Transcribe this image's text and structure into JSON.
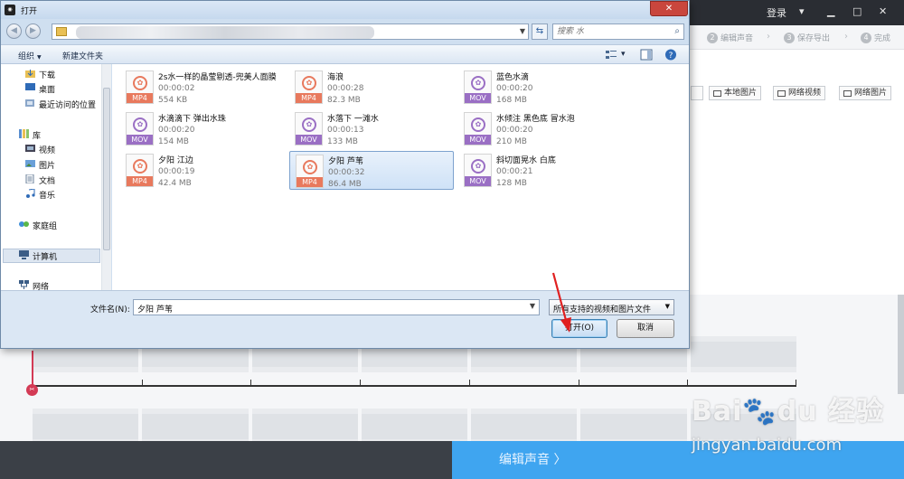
{
  "app": {
    "topbar": {
      "login_label": "登录"
    },
    "steps": [
      {
        "num": "2",
        "label": "编辑声音"
      },
      {
        "num": "3",
        "label": "保存导出"
      },
      {
        "num": "4",
        "label": "完成"
      }
    ],
    "media_buttons": [
      "本地图片",
      "网络视频",
      "网络图片"
    ],
    "next_button_label": "编辑声音 〉"
  },
  "dialog": {
    "title": "打开",
    "close_label": "✕",
    "search_placeholder": "搜索 水",
    "toolbar": {
      "organize_label": "组织",
      "new_folder_label": "新建文件夹"
    },
    "nav_items": [
      {
        "label": "下载",
        "icon": "download-folder-icon"
      },
      {
        "label": "桌面",
        "icon": "desktop-icon"
      },
      {
        "label": "最近访问的位置",
        "icon": "recent-places-icon"
      },
      {
        "label": "库",
        "icon": "library-icon"
      },
      {
        "label": "视频",
        "icon": "videos-icon"
      },
      {
        "label": "图片",
        "icon": "pictures-icon"
      },
      {
        "label": "文档",
        "icon": "documents-icon"
      },
      {
        "label": "音乐",
        "icon": "music-icon"
      },
      {
        "label": "家庭组",
        "icon": "homegroup-icon"
      },
      {
        "label": "计算机",
        "icon": "computer-icon"
      },
      {
        "label": "网络",
        "icon": "network-icon"
      }
    ],
    "files": [
      {
        "name": "2s水一样的晶莹剔透-兜美人面膜",
        "duration": "00:00:02",
        "size": "554 KB",
        "format": "MP4"
      },
      {
        "name": "海浪",
        "duration": "00:00:28",
        "size": "82.3 MB",
        "format": "MP4"
      },
      {
        "name": "蓝色水滴",
        "duration": "00:00:20",
        "size": "168 MB",
        "format": "MOV"
      },
      {
        "name": "水滴滴下 弹出水珠",
        "duration": "00:00:20",
        "size": "154 MB",
        "format": "MOV"
      },
      {
        "name": "水落下 一滩水",
        "duration": "00:00:13",
        "size": "133 MB",
        "format": "MOV"
      },
      {
        "name": "水倾注 黑色底 冒水泡",
        "duration": "00:00:20",
        "size": "210 MB",
        "format": "MOV"
      },
      {
        "name": "夕阳 江边",
        "duration": "00:00:19",
        "size": "42.4 MB",
        "format": "MP4"
      },
      {
        "name": "夕阳 芦苇",
        "duration": "00:00:32",
        "size": "86.4 MB",
        "format": "MP4",
        "selected": true
      },
      {
        "name": "斜切面晃水 白底",
        "duration": "00:00:21",
        "size": "128 MB",
        "format": "MOV"
      }
    ],
    "filename_label": "文件名(N):",
    "filename_value": "夕阳 芦苇",
    "filter_value": "所有支持的视频和图片文件",
    "open_label": "打开(O)",
    "cancel_label": "取消"
  },
  "watermark": {
    "logo": "Bai🐾du 经验",
    "url": "jingyan.baidu.com"
  },
  "colors": {
    "mp4": "#e8795d",
    "mov": "#9a6fc4",
    "accent": "#3fa5f0",
    "playhead": "#d33a55"
  }
}
